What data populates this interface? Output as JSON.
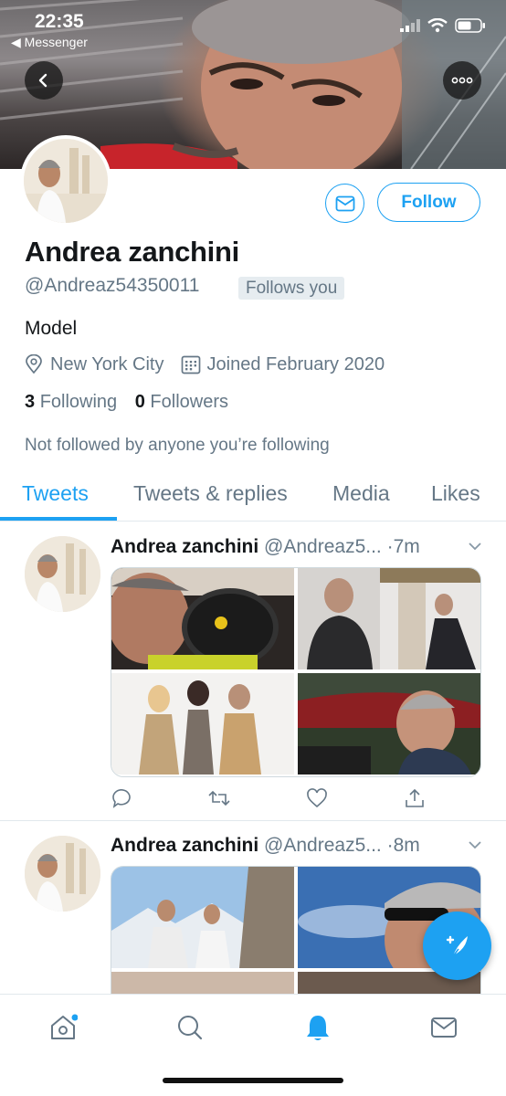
{
  "status_bar": {
    "time": "22:35",
    "back_app": "◀ Messenger"
  },
  "profile": {
    "name": "Andrea zanchini",
    "handle": "@Andreaz54350011",
    "follows_you_badge": "Follows you",
    "bio": "Model",
    "location": "New York City",
    "joined": "Joined February 2020",
    "following_count": "3",
    "following_label": "Following",
    "followers_count": "0",
    "followers_label": "Followers",
    "not_followed_text": "Not followed by anyone you’re following",
    "follow_button_label": "Follow"
  },
  "tabs": [
    {
      "label": "Tweets",
      "active": true
    },
    {
      "label": "Tweets & replies",
      "active": false
    },
    {
      "label": "Media",
      "active": false
    },
    {
      "label": "Likes",
      "active": false
    }
  ],
  "tweets": [
    {
      "name": "Andrea zanchini",
      "handle": "@Andreaz5...",
      "time": "·7m"
    },
    {
      "name": "Andrea zanchini",
      "handle": "@Andreaz5...",
      "time": "·8m"
    }
  ],
  "icons": {
    "back": "chevron-left-icon",
    "more": "more-icon",
    "message": "envelope-icon",
    "location": "location-pin-icon",
    "calendar": "calendar-icon",
    "reply": "reply-icon",
    "retweet": "retweet-icon",
    "like": "heart-icon",
    "share": "share-icon",
    "compose": "compose-icon",
    "home": "home-icon",
    "search": "search-icon",
    "notifications": "bell-icon",
    "messages": "envelope-icon"
  },
  "colors": {
    "accent": "#1da1f2",
    "text_primary": "#14171a",
    "text_secondary": "#657786"
  }
}
